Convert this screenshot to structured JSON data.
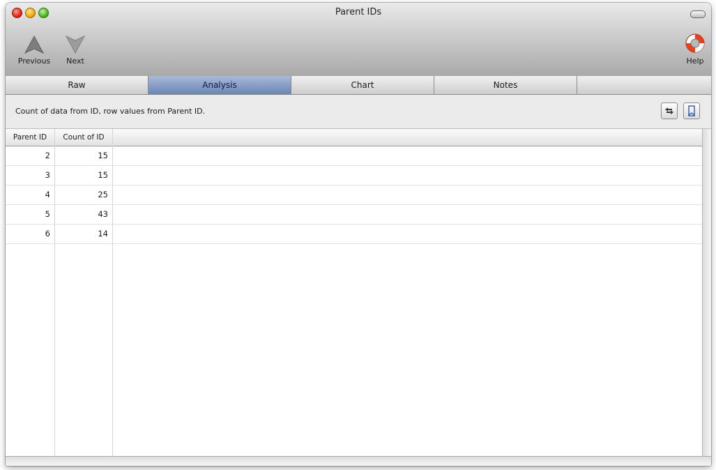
{
  "window": {
    "title": "Parent IDs"
  },
  "toolbar": {
    "previous_label": "Previous",
    "next_label": "Next",
    "help_label": "Help"
  },
  "tabs": [
    {
      "label": "Raw",
      "active": false
    },
    {
      "label": "Analysis",
      "active": true
    },
    {
      "label": "Chart",
      "active": false
    },
    {
      "label": "Notes",
      "active": false
    }
  ],
  "info": {
    "text": "Count of data from ID, row values from Parent ID."
  },
  "table": {
    "columns": [
      "Parent ID",
      "Count of ID"
    ],
    "rows": [
      [
        "2",
        "15"
      ],
      [
        "3",
        "15"
      ],
      [
        "4",
        "25"
      ],
      [
        "5",
        "43"
      ],
      [
        "6",
        "14"
      ]
    ]
  },
  "colors": {
    "active_tab": "#6b86b8",
    "help_icon_red": "#e8401c"
  },
  "icons": {
    "previous": "arrow-up-icon",
    "next": "arrow-down-icon",
    "help": "lifebuoy-icon",
    "swap": "swap-arrows-icon",
    "bookmark": "bookmark-icon"
  }
}
